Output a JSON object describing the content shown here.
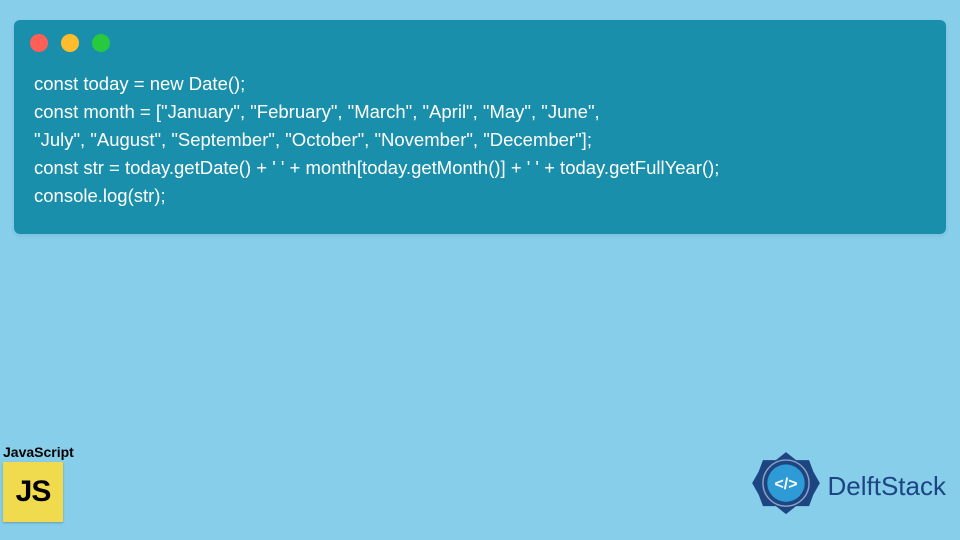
{
  "window": {
    "dots": [
      "red",
      "yellow",
      "green"
    ]
  },
  "code": {
    "line1": "const today = new Date();",
    "line2": "const month = [\"January\", \"February\", \"March\", \"April\", \"May\", \"June\",",
    "line3": "\"July\", \"August\", \"September\", \"October\", \"November\", \"December\"];",
    "line4": "const str = today.getDate() + ' ' + month[today.getMonth()] + ' ' + today.getFullYear();",
    "line5": "console.log(str);"
  },
  "badge": {
    "label": "JavaScript",
    "logo_text": "JS"
  },
  "brand": {
    "name": "DelftStack"
  },
  "colors": {
    "page_bg": "#87CEEB",
    "window_bg": "#1A8FAC",
    "code_fg": "#FFFFFF",
    "js_bg": "#F0DB4F",
    "brand_fg": "#1C4582"
  }
}
